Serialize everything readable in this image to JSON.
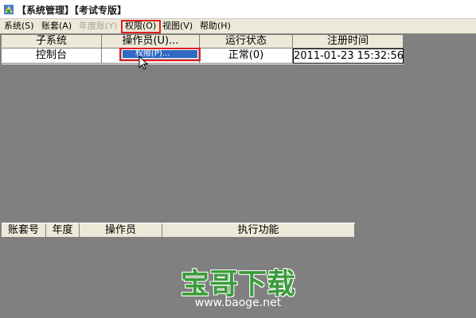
{
  "window": {
    "title": "【系统管理】【考试专版】",
    "icon": "app-icon"
  },
  "menubar": {
    "items": [
      {
        "label": "系统(S)",
        "enabled": true
      },
      {
        "label": "账套(A)",
        "enabled": true
      },
      {
        "label": "年度账(Y)",
        "enabled": false
      },
      {
        "label": "权限(O)",
        "enabled": true,
        "active": true
      },
      {
        "label": "视图(V)",
        "enabled": true
      },
      {
        "label": "帮助(H)",
        "enabled": true
      }
    ]
  },
  "top_table": {
    "headers": [
      "子系统",
      "操作员(U)...",
      "运行状态",
      "注册时间"
    ],
    "rows": [
      [
        "控制台",
        "",
        "正常(0)",
        "2011-01-23 15:32:56"
      ]
    ]
  },
  "dropdown_menu": {
    "items": [
      {
        "label": "权限(P)...",
        "selected": true
      }
    ]
  },
  "bottom_table": {
    "headers": [
      "账套号",
      "年度",
      "操作员",
      "执行功能"
    ]
  },
  "watermark": {
    "text": "宝哥下载",
    "url": "www.baoge.net"
  },
  "colors": {
    "background": "#808080",
    "menubar": "#ece9d8",
    "highlight_border": "#e02020",
    "selection": "#316ac5",
    "watermark_green": "#3a9b3a"
  }
}
